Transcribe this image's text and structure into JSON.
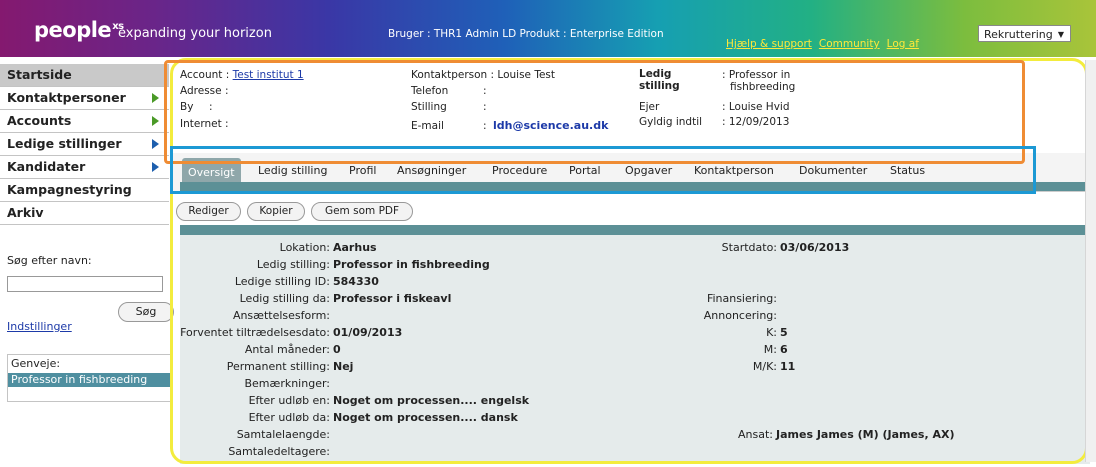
{
  "header": {
    "logo": "people",
    "logo_sup": "xs",
    "tagline": "expanding your horizon",
    "user_info": "Bruger : THR1 Admin LD  Produkt : Enterprise Edition",
    "links": [
      "Hjælp & support",
      "Community",
      "Log af"
    ],
    "module_select": "Rekruttering"
  },
  "nav": {
    "items": [
      {
        "label": "Startside",
        "arrow": ""
      },
      {
        "label": "Kontaktpersoner",
        "arrow": "green"
      },
      {
        "label": "Accounts",
        "arrow": "green"
      },
      {
        "label": "Ledige stillinger",
        "arrow": "blue"
      },
      {
        "label": "Kandidater",
        "arrow": "blue"
      },
      {
        "label": "Kampagnestyring",
        "arrow": ""
      },
      {
        "label": "Arkiv",
        "arrow": ""
      }
    ],
    "search_label": "Søg efter navn:",
    "search_button": "Søg",
    "settings_link": "Indstillinger",
    "shortcuts_label": "Genveje:",
    "shortcut_item": "Professor in fishbreeding"
  },
  "account": {
    "account_label": "Account :",
    "account_value": "Test institut 1",
    "address_label": "Adresse :",
    "city_label": "By",
    "city_colon": ":",
    "internet_label": "Internet :",
    "contact_label": "Kontaktperson :",
    "contact_value": "Louise Test",
    "phone_label": "Telefon",
    "phone_colon": ":",
    "position_label": "Stilling",
    "position_colon": ":",
    "email_label": "E-mail",
    "email_colon": ":",
    "email_value": "ldh@science.au.dk",
    "vacancy_label_1": "Ledig",
    "vacancy_label_2": "stilling",
    "vacancy_value_1": ": Professor in",
    "vacancy_value_2": "fishbreeding",
    "owner_label": "Ejer",
    "owner_value": ": Louise Hvid",
    "valid_label": "Gyldig indtil",
    "valid_value": ": 12/09/2013"
  },
  "tabs": [
    "Oversigt",
    "Ledig stilling",
    "Profil",
    "Ansøgninger",
    "Procedure",
    "Portal",
    "Opgaver",
    "Kontaktperson",
    "Dokumenter",
    "Status"
  ],
  "buttons": [
    "Rediger",
    "Kopier",
    "Gem som PDF"
  ],
  "details_left": [
    {
      "label": "Lokation:",
      "value": "Aarhus"
    },
    {
      "label": "Ledig stilling:",
      "value": "Professor in fishbreeding"
    },
    {
      "label": "Ledige stilling ID:",
      "value": "584330"
    },
    {
      "label": "Ledig stilling da:",
      "value": "Professor i fiskeavl"
    },
    {
      "label": "Ansættelsesform:",
      "value": ""
    },
    {
      "label": "Forventet tiltrædelsesdato:",
      "value": "01/09/2013"
    },
    {
      "label": "Antal måneder:",
      "value": "0"
    },
    {
      "label": "Permanent stilling:",
      "value": "Nej"
    },
    {
      "label": "Bemærkninger:",
      "value": ""
    },
    {
      "label": "Efter udløb en:",
      "value": "Noget om processen.... engelsk"
    },
    {
      "label": "Efter udløb da:",
      "value": "Noget om processen.... dansk"
    },
    {
      "label": "Samtalelaengde:",
      "value": ""
    },
    {
      "label": "Samtaledeltagere:",
      "value": ""
    }
  ],
  "details_right": [
    {
      "label": "Startdato:",
      "value": "03/06/2013"
    },
    {
      "label": "Finansiering:",
      "value": ""
    },
    {
      "label": "Annoncering:",
      "value": ""
    },
    {
      "label": "K:",
      "value": "5"
    },
    {
      "label": "M:",
      "value": "6"
    },
    {
      "label": "M/K:",
      "value": "11"
    },
    {
      "label": "Ansat:",
      "value": "James James (M) (James, AX)"
    }
  ],
  "colors": {
    "highlight_orange": "#ef8c34",
    "highlight_blue": "#1c99d4",
    "highlight_yellow": "#f3ec3d",
    "teal": "#5c9096",
    "link": "#1d3aa8"
  }
}
